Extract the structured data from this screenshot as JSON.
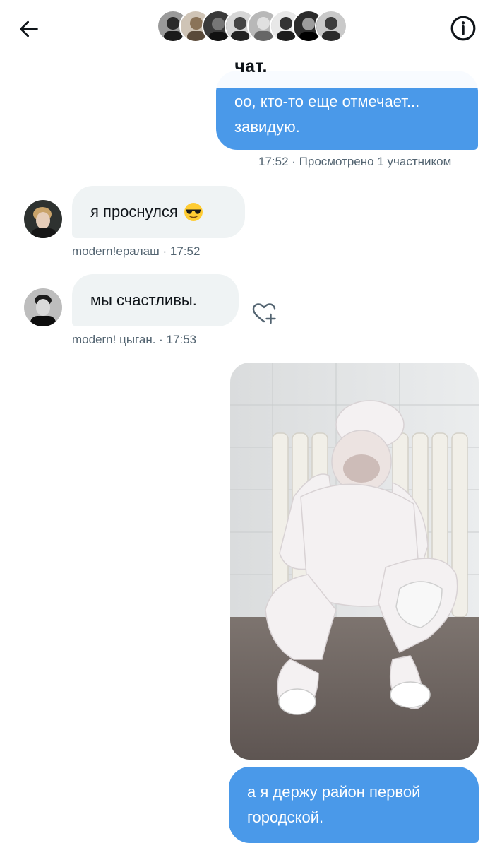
{
  "header": {
    "title": "чат.",
    "back_icon": "arrow-left-icon",
    "info_icon": "info-circle-icon"
  },
  "messages": [
    {
      "direction": "out",
      "text_line1": "оо, кто-то еще отмечает...",
      "text_line2": "завидую.",
      "time": "17:52",
      "status": "Просмотрено 1 участником"
    },
    {
      "direction": "in",
      "text": "я проснулся",
      "emoji": "smiling-face-with-sunglasses",
      "sender": "modern!ералаш",
      "time": "17:52"
    },
    {
      "direction": "in",
      "text": "мы счастливы.",
      "sender": "modern! цыган.",
      "time": "17:53"
    },
    {
      "direction": "out",
      "type": "image"
    },
    {
      "direction": "out",
      "text_line1": "а я держу район первой",
      "text_line2": "городской."
    }
  ],
  "colors": {
    "outgoing_bubble": "#4a99e9",
    "incoming_bubble": "#eff3f4",
    "meta_text": "#536471"
  }
}
